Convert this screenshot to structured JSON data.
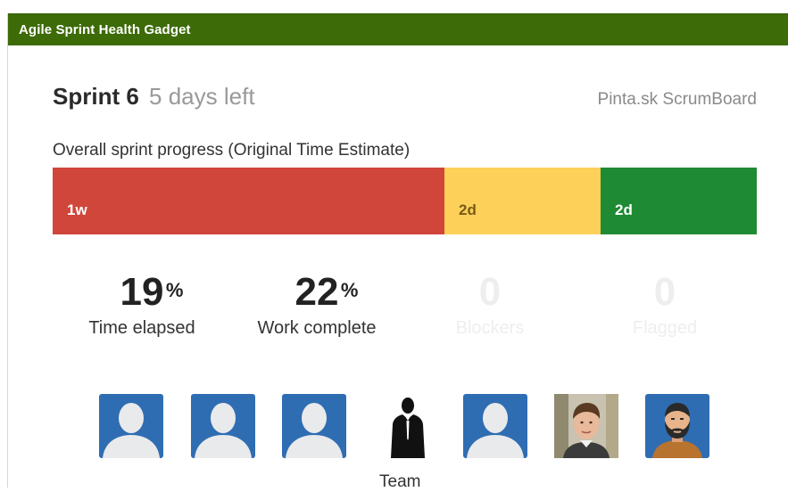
{
  "gadget": {
    "title": "Agile Sprint Health Gadget",
    "header_color": "#3d6b07"
  },
  "sprint": {
    "name": "Sprint 6",
    "time_left": "5 days left",
    "board_link": "Pinta.sk ScrumBoard"
  },
  "progress": {
    "label": "Overall sprint progress (Original Time Estimate)",
    "segments": [
      {
        "label": "1w",
        "fraction": 0.5563,
        "color": "#d0463a",
        "text_color": "#ffffff"
      },
      {
        "label": "2d",
        "fraction": 0.2218,
        "color": "#fdd05a",
        "text_color": "#7a5a18"
      },
      {
        "label": "2d",
        "fraction": 0.2219,
        "color": "#1f8a34",
        "text_color": "#ffffff"
      }
    ]
  },
  "stats": [
    {
      "value": "19",
      "suffix": "%",
      "caption": "Time elapsed"
    },
    {
      "value": "22",
      "suffix": "%",
      "caption": "Work complete"
    },
    {
      "value": "0",
      "suffix": "",
      "caption": "Blockers"
    },
    {
      "value": "0",
      "suffix": "",
      "caption": "Flagged"
    }
  ],
  "team": {
    "label": "Team",
    "icon": "team-icon",
    "avatars": [
      "default-avatar",
      "default-avatar",
      "default-avatar",
      "default-avatar",
      "photo-avatar",
      "bearded-man-avatar"
    ]
  }
}
